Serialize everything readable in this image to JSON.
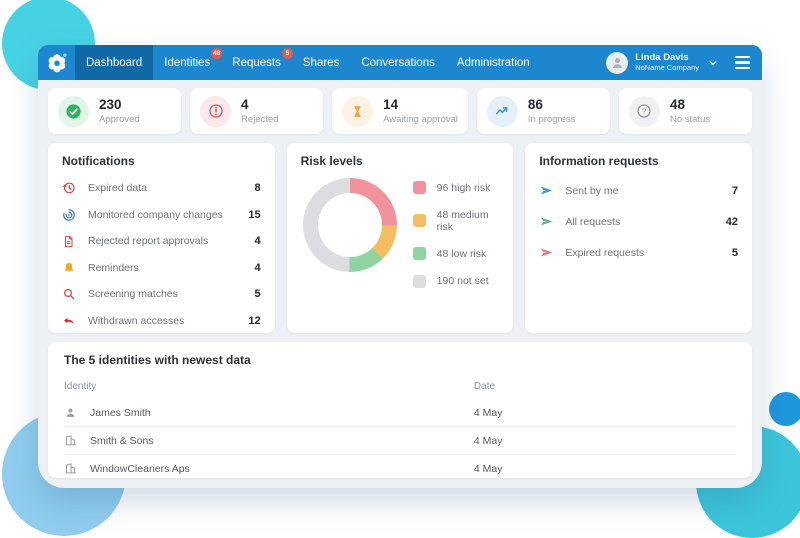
{
  "nav": {
    "items": [
      {
        "label": "Dashboard",
        "active": true
      },
      {
        "label": "Identities",
        "badge": "48"
      },
      {
        "label": "Requests",
        "badge": "5"
      },
      {
        "label": "Shares"
      },
      {
        "label": "Conversations"
      },
      {
        "label": "Administration"
      }
    ],
    "user": {
      "name": "Linda Davis",
      "company": "NoName Company"
    },
    "colors": {
      "bar": "#1c86cf",
      "active_tab": "#1168a7",
      "badge": "#f0564f"
    }
  },
  "stats": {
    "items": [
      {
        "value": "230",
        "label": "Approved",
        "icon": "check-circle-icon",
        "color": "#2db55d"
      },
      {
        "value": "4",
        "label": "Rejected",
        "icon": "alert-circle-icon",
        "color": "#dd5560"
      },
      {
        "value": "14",
        "label": "Awaiting approval",
        "icon": "hourglass-icon",
        "color": "#efa53c"
      },
      {
        "value": "86",
        "label": "In progress",
        "icon": "trending-up-icon",
        "color": "#3b97d3"
      },
      {
        "value": "48",
        "label": "No status",
        "icon": "question-circle-icon",
        "color": "#8d949c"
      }
    ]
  },
  "notifications": {
    "title": "Notifications",
    "items": [
      {
        "icon": "history-icon",
        "label": "Expired data",
        "count": "8",
        "color": "#d0453f"
      },
      {
        "icon": "monitoring-icon",
        "label": "Monitored company changes",
        "count": "15",
        "color": "#2f7fd0"
      },
      {
        "icon": "document-icon",
        "label": "Rejected report approvals",
        "count": "4",
        "color": "#d0453f"
      },
      {
        "icon": "bell-icon",
        "label": "Reminders",
        "count": "4",
        "color": "#f5a623"
      },
      {
        "icon": "magnifier-icon",
        "label": "Screening matches",
        "count": "5",
        "color": "#d0453f"
      },
      {
        "icon": "undo-arrow-icon",
        "label": "Withdrawn accesses",
        "count": "12",
        "color": "#c9302c"
      }
    ]
  },
  "risk": {
    "title": "Risk levels"
  },
  "chart_data": {
    "type": "pie",
    "variant": "donut",
    "title": "Risk levels",
    "labels": [
      "96 high risk",
      "48 medium risk",
      "48 low risk",
      "190 not set"
    ],
    "values": [
      96,
      48,
      48,
      190
    ],
    "colors": [
      "#f2939b",
      "#f5bd62",
      "#8fd3a0",
      "#dcdde1"
    ],
    "start_angle_deg": 0,
    "legend_position": "right"
  },
  "info_requests": {
    "title": "Information requests",
    "items": [
      {
        "icon": "send-icon",
        "label": "Sent by me",
        "count": "7",
        "color": "#3b97d3"
      },
      {
        "icon": "send-icon",
        "label": "All requests",
        "count": "42",
        "color": "#57b87c"
      },
      {
        "icon": "send-icon",
        "label": "Expired requests",
        "count": "5",
        "color": "#e8707c"
      }
    ]
  },
  "identities_table": {
    "title": "The 5 identities with newest data",
    "columns": [
      "Identity",
      "Date"
    ],
    "rows": [
      {
        "icon": "person-icon",
        "name": "James Smith",
        "date": "4 May"
      },
      {
        "icon": "building-icon",
        "name": "Smith & Sons",
        "date": "4 May"
      },
      {
        "icon": "building-icon",
        "name": "WindowCleaners Aps",
        "date": "4 May"
      }
    ]
  }
}
